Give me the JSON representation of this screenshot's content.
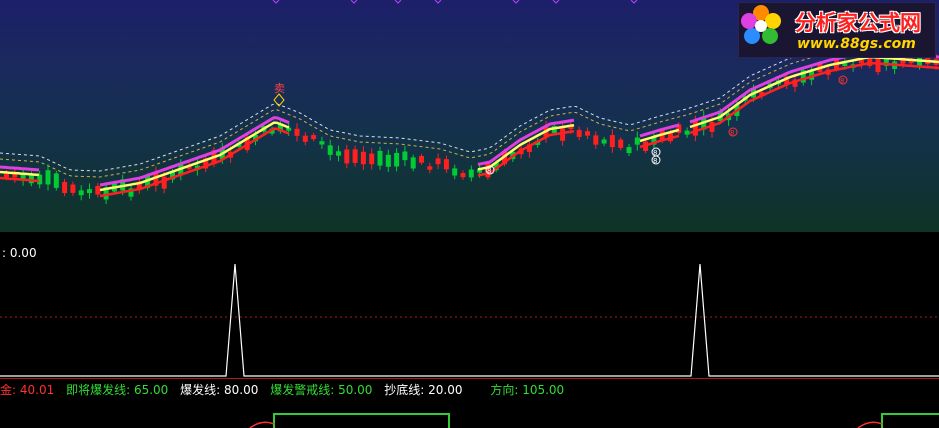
{
  "colors": {
    "up": "#ff2020",
    "down": "#00cc33",
    "line_magenta": "#e040e0",
    "line_yellow": "#ffff66",
    "line_red": "#ff2020",
    "dash_white": "#ffffff",
    "dash_yellow": "#ffd24a",
    "divider": "#b01818",
    "indicator_line": "#ffffff",
    "bottom_box": "#33cc33"
  },
  "logo": {
    "title": "分析家公式网",
    "url": "www.88gs.com",
    "icon": "flower-icon"
  },
  "price_panel": {
    "signal_sell_label": "卖",
    "signal_marker_label": "8"
  },
  "indicator_panel": {
    "value_readout": ": 0.00"
  },
  "bottom_panel": {
    "params": [
      {
        "label": "金:",
        "value": "40.01",
        "color": "#ff3030"
      },
      {
        "label": "即将爆发线:",
        "value": "65.00",
        "color": "#33dd33"
      },
      {
        "label": "爆发线:",
        "value": "80.00",
        "color": "#ffffff"
      },
      {
        "label": "爆发警戒线:",
        "value": "50.00",
        "color": "#33dd33"
      },
      {
        "label": "抄底线:",
        "value": "20.00",
        "color": "#ffffff"
      },
      {
        "label": "方向:",
        "value": "105.00",
        "color": "#33dd33"
      }
    ]
  }
}
